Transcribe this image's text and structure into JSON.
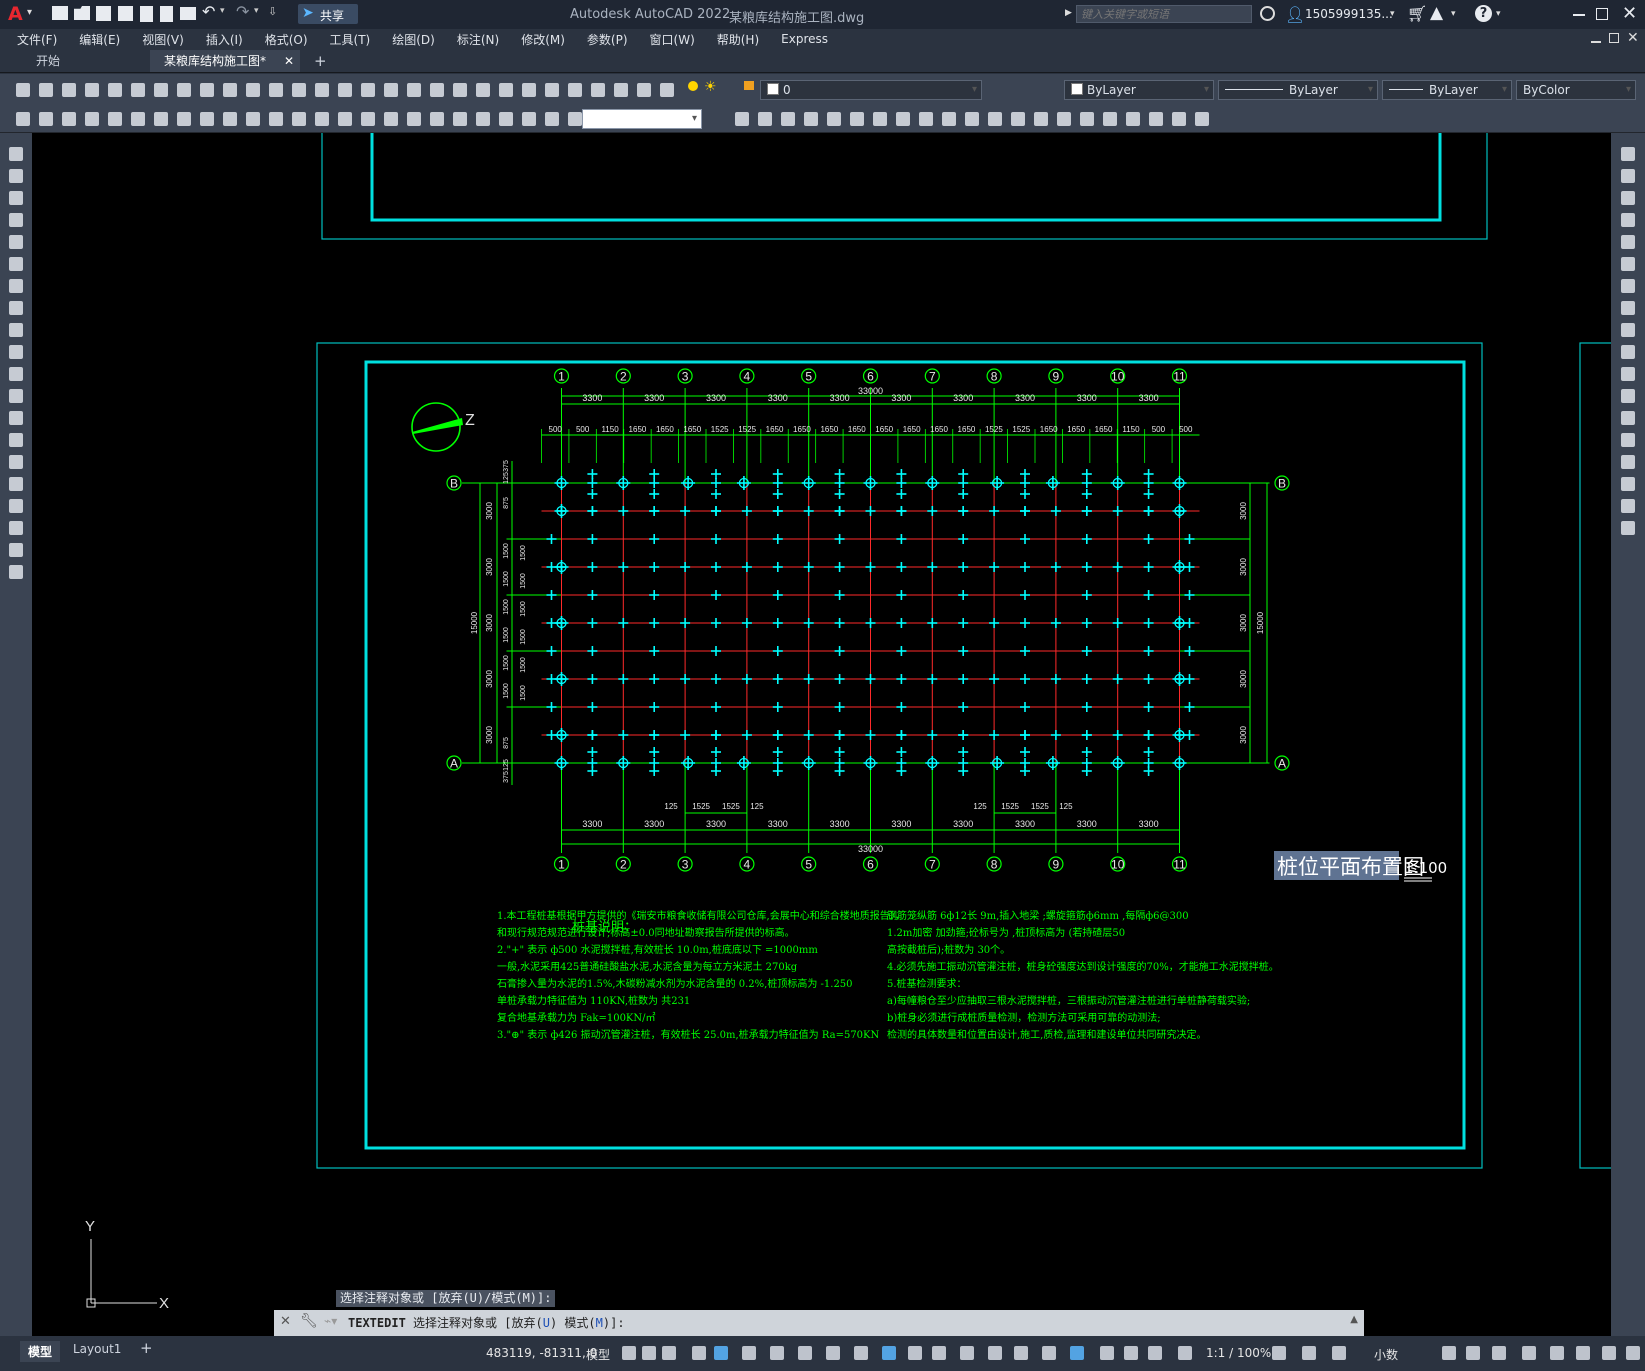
{
  "titlebar": {
    "app_logo": "A",
    "share_label": "共享",
    "title": "Autodesk AutoCAD 2022",
    "file": "某粮库结构施工图.dwg",
    "search_placeholder": "键入关键字或短语",
    "user": "1505999135...",
    "icons": [
      "new-file-icon",
      "open-icon",
      "save-icon",
      "save-as-icon",
      "publish-icon",
      "plot-icon",
      "undo-icon",
      "redo-icon",
      "share-icon",
      "search-icon",
      "user-icon",
      "cart-icon",
      "autodesk-icon",
      "help-icon",
      "minimize-icon",
      "maximize-icon",
      "close-icon"
    ]
  },
  "menu": [
    "文件(F)",
    "编辑(E)",
    "视图(V)",
    "插入(I)",
    "格式(O)",
    "工具(T)",
    "绘图(D)",
    "标注(N)",
    "修改(M)",
    "参数(P)",
    "窗口(W)",
    "帮助(H)",
    "Express"
  ],
  "tabs": [
    "开始",
    "某粮库结构施工图*"
  ],
  "tab_add": "+",
  "properties": {
    "layer": "0",
    "color": "ByLayer",
    "linetype": "ByLayer",
    "lineweight": "ByLayer",
    "plotstyle": "ByColor"
  },
  "drawing": {
    "axis_numbers": [
      "1",
      "2",
      "3",
      "4",
      "5",
      "6",
      "7",
      "8",
      "9",
      "10",
      "11"
    ],
    "axis_letters": [
      "A",
      "B"
    ],
    "north_label": "Z",
    "total_width": "33000",
    "bay_span": "3300",
    "detail_dims_top": [
      "500",
      "500",
      "1150",
      "1650",
      "1650",
      "1650",
      "1525",
      "1525",
      "1650",
      "1650",
      "1650",
      "1650",
      "1650",
      "1650",
      "1650",
      "1650",
      "1525",
      "1525",
      "1650",
      "1650",
      "1650",
      "1150",
      "500",
      "500"
    ],
    "detail_dims_bottom": [
      "125",
      "1525",
      "1525",
      "125"
    ],
    "left_dims": [
      "375",
      "125",
      "875",
      "1500",
      "1500",
      "1500",
      "1500",
      "1500",
      "1500",
      "875",
      "125",
      "375"
    ],
    "row_span": "3000",
    "total_height": "15000",
    "title": "桩位平面布置图",
    "scale": "1:100",
    "notes_title": "桩基说明：",
    "notes_left": [
      "1.本工程桩基根据甲方提供的《瑞安市粮食收储有限公司仓库,会展中心和综合楼地质报告》，",
      "  和现行规范规范进行设计;标高±0.0同地址勘察报告所提供的标高。",
      "2.\"+\" 表示 ф500 水泥搅拌桩,有效桩长 10.0m,桩底底以下   =1000mm",
      "  一般,水泥采用425普通硅酸盐水泥,水泥含量为每立方米泥土  270kg",
      "  石膏掺入量为水泥的1.5%,木碳粉减水剂为水泥含量的 0.2%,桩顶标高为  -1.250",
      "  单桩承载力特征值为 110KN,桩数为  共231",
      "  复合地基承载力为 Fak=100KN/㎡",
      "3.\"⊕\" 表示 ф426 振动沉管灌注桩，有效桩长 25.0m,桩承载力特征值为    Ra=570KN"
    ],
    "notes_right": [
      "钢筋笼纵筋 6ф12长   9m,插入地梁    ;螺旋箍筋ф6mm  ,每隔ф6@300",
      "1.2m加密   加劲箍;砼标号为  ,桩顶标高为  (若持碴层50",
      "高按截桩后);桩数为 30个。",
      "4.必须先施工振动沉管灌注桩，桩身砼强度达到设计强度的70%，才能施工水泥搅拌桩。",
      "5.桩基检测要求：",
      "  a)每幢粮仓至少应抽取三根水泥搅拌桩，三根振动沉管灌注桩进行单桩静荷载实验;",
      "  b)桩身必须进行成桩质量检测，检测方法可采用可靠的动测法;",
      "   检测的具体数量和位置由设计,施工,质检,监理和建设单位共同研究决定。"
    ]
  },
  "ucs": {
    "x": "X",
    "y": "Y"
  },
  "command": {
    "history": "选择注释对象或 [放弃(U)/模式(M)]:",
    "name": "TEXTEDIT",
    "prompt": "选择注释对象或",
    "opt_prefix": "[放弃(",
    "opt_u": "U",
    "opt_mid": ") 模式(",
    "opt_m": "M",
    "opt_suffix": ")]:"
  },
  "layout_tabs": [
    "模型",
    "Layout1"
  ],
  "layout_add": "+",
  "status": {
    "coords": "483119, -81311, 0",
    "space": "模型",
    "scale": "1:1 / 100%",
    "units": "小数"
  }
}
